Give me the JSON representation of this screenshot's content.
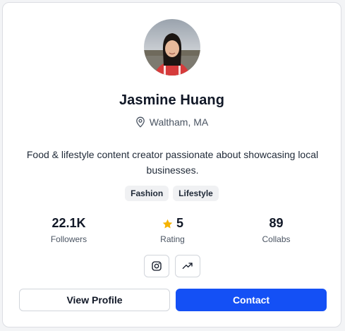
{
  "profile": {
    "name": "Jasmine Huang",
    "location": "Waltham, MA",
    "bio": "Food & lifestyle content creator passionate about showcasing local businesses.",
    "avatar_icon": "profile-photo"
  },
  "tags": [
    "Fashion",
    "Lifestyle"
  ],
  "stats": {
    "followers": {
      "value": "22.1K",
      "label": "Followers"
    },
    "rating": {
      "value": "5",
      "label": "Rating",
      "icon": "star-icon"
    },
    "collabs": {
      "value": "89",
      "label": "Collabs"
    }
  },
  "socials": [
    {
      "icon": "instagram-icon"
    },
    {
      "icon": "trending-up-icon"
    }
  ],
  "actions": {
    "view_profile_label": "View Profile",
    "contact_label": "Contact"
  },
  "colors": {
    "accent": "#1450f5",
    "star": "#f5b301",
    "tag_bg": "#f0f1f3",
    "text": "#111827",
    "muted": "#4b5563"
  }
}
